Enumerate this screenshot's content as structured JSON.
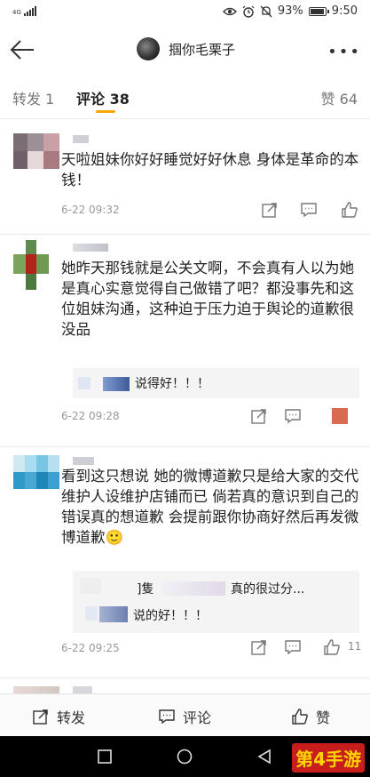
{
  "status_bar": {
    "network": "4G",
    "battery": "93%",
    "time": "9:50"
  },
  "header": {
    "title": "掴你毛栗子",
    "more": "•••"
  },
  "tabs": {
    "repost": "转发 1",
    "comment": "评论 38",
    "like": "赞 64"
  },
  "comments": [
    {
      "text": "天啦姐妹你好好睡觉好好休息 身体是革命的本钱！",
      "time": "6-22 09:32"
    },
    {
      "text": "她昨天那钱就是公关文啊，不会真有人以为她是真心实意觉得自己做错了吧？都没事先和这位姐妹沟通，这种迫于压力迫于舆论的道歉很没品",
      "reply": "说得好！！！",
      "time": "6-22 09:28"
    },
    {
      "text": "看到这只想说 她的微博道歉只是给大家的交代 维护人设维护店铺而已 倘若真的意识到自己的错误真的想道歉 会提前跟你协商好然后再发微博道歉🙂",
      "reply_line1_a": "]隻",
      "reply_line1_b": "真的很过分...",
      "reply_line2": "说的好！！！",
      "time": "6-22 09:25",
      "likes": "11"
    }
  ],
  "bottom_bar": {
    "repost": "转发",
    "comment": "评论",
    "like": "赞"
  },
  "watermark": "第4手游",
  "colors": {
    "accent": "#f7a500",
    "text": "#222222",
    "muted": "#999999"
  }
}
